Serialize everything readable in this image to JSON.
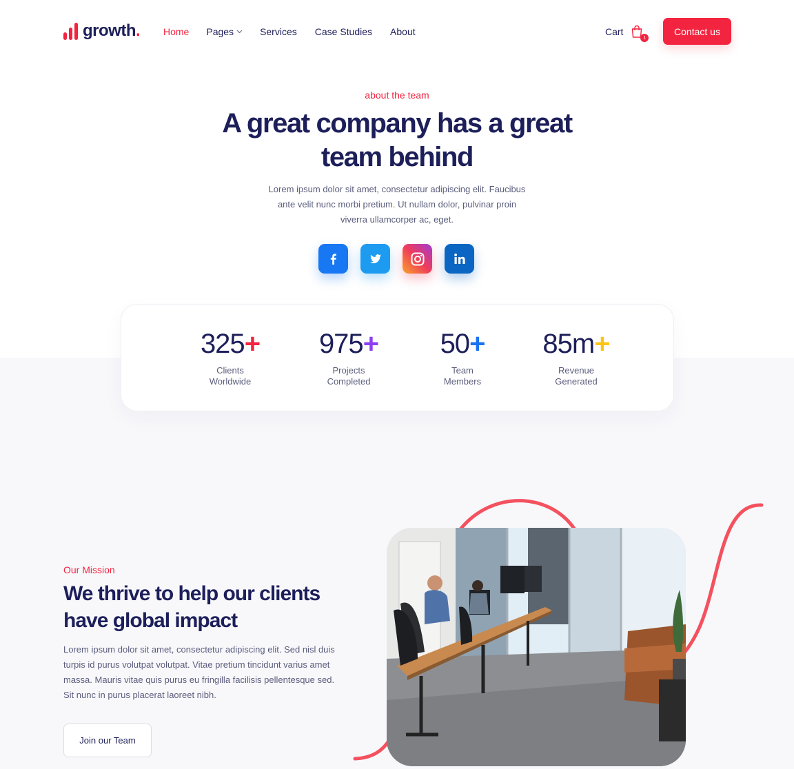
{
  "header": {
    "logo_text": "growth",
    "logo_dot": ".",
    "nav": [
      {
        "label": "Home",
        "active": true
      },
      {
        "label": "Pages",
        "has_dropdown": true
      },
      {
        "label": "Services"
      },
      {
        "label": "Case Studies"
      },
      {
        "label": "About"
      }
    ],
    "cart_label": "Cart",
    "cart_count": "1",
    "contact_label": "Contact us"
  },
  "hero": {
    "kicker": "about the team",
    "title": "A great company has a great team behind",
    "text": "Lorem ipsum dolor sit amet, consectetur adipiscing elit. Faucibus ante velit nunc morbi pretium. Ut nullam dolor, pulvinar proin viverra ullamcorper ac, eget.",
    "socials": [
      {
        "name": "facebook",
        "icon": "facebook-icon",
        "color": "#1877f2"
      },
      {
        "name": "twitter",
        "icon": "twitter-icon",
        "color": "#1d9bf0"
      },
      {
        "name": "instagram",
        "icon": "instagram-icon",
        "color": "#ee3c5b"
      },
      {
        "name": "linkedin",
        "icon": "linkedin-icon",
        "color": "#0a66c2"
      }
    ]
  },
  "stats": [
    {
      "value": "325",
      "plus": "+",
      "plus_color": "#f2243f",
      "label_line1": "Clients",
      "label_line2": "Worldwide"
    },
    {
      "value": "975",
      "plus": "+",
      "plus_color": "#8b3ff0",
      "label_line1": "Projects",
      "label_line2": "Completed"
    },
    {
      "value": "50",
      "plus": "+",
      "plus_color": "#1a73f0",
      "label_line1": "Team",
      "label_line2": "Members"
    },
    {
      "value": "85m",
      "plus": "+",
      "plus_color": "#fcc419",
      "label_line1": "Revenue",
      "label_line2": "Generated"
    }
  ],
  "mission": {
    "kicker": "Our Mission",
    "title": "We thrive to help our clients have global impact",
    "text": "Lorem ipsum dolor sit amet, consectetur adipiscing elit. Sed nisl duis turpis id purus volutpat volutpat. Vitae pretium tincidunt varius amet massa. Mauris vitae quis purus eu fringilla facilisis pellentesque sed. Sit nunc in purus placerat laoreet nibh.",
    "button_label": "Join our Team",
    "image": "office-photo"
  },
  "colors": {
    "accent": "#f2243f",
    "navy": "#1d1f5a",
    "body_text": "#5a5d7c"
  }
}
